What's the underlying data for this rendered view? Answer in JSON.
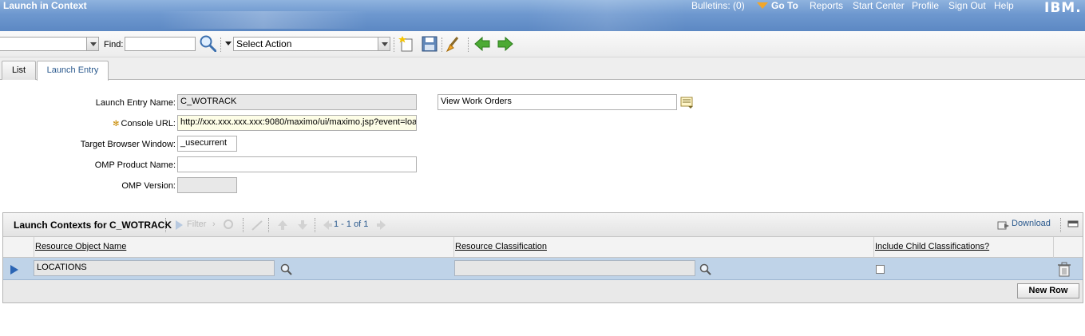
{
  "header": {
    "app_title": "Launch in Context",
    "bulletins": "Bulletins: (0)",
    "go_to": "Go To",
    "reports": "Reports",
    "start_center": "Start Center",
    "profile": "Profile",
    "sign_out": "Sign Out",
    "help": "Help",
    "logo": "IBM."
  },
  "toolbar": {
    "find_label": "Find:",
    "find_value": "",
    "select_action": "Select Action"
  },
  "tabs": [
    {
      "label": "List"
    },
    {
      "label": "Launch Entry"
    }
  ],
  "form": {
    "launch_entry_name_label": "Launch Entry Name:",
    "launch_entry_name_value": "C_WOTRACK",
    "description_value": "View Work Orders",
    "console_url_label": "Console URL:",
    "console_url_value": "http://xxx.xxx.xxx.xxx:9080/maximo/ui/maximo.jsp?event=loa",
    "target_browser_label": "Target Browser Window:",
    "target_browser_value": "_usecurrent",
    "omp_product_label": "OMP Product Name:",
    "omp_product_value": "",
    "omp_version_label": "OMP Version:",
    "omp_version_value": ""
  },
  "table": {
    "title": "Launch Contexts for C_WOTRACK",
    "filter_label": "Filter",
    "paging": "1 - 1 of 1",
    "download": "Download",
    "columns": [
      "Resource Object Name",
      "Resource Classification",
      "Include Child Classifications?"
    ],
    "rows": [
      {
        "resource_object_name": "LOCATIONS",
        "resource_classification": "",
        "include_child": false
      }
    ],
    "new_row": "New Row"
  }
}
